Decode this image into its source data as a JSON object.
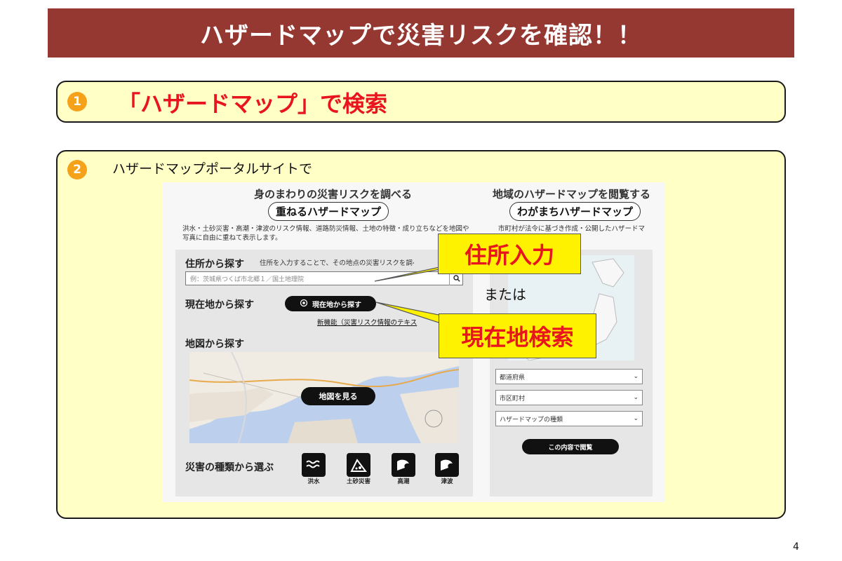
{
  "title": "ハザードマップで災害リスクを確認！！",
  "step1": {
    "number": "1",
    "text": "「ハザードマップ」で検索"
  },
  "step2": {
    "number": "2",
    "text": "ハザードマップポータルサイトで"
  },
  "portal": {
    "left_heading": "身のまわりの災害リスクを調べる",
    "left_pill": "重ねるハザードマップ",
    "left_desc": "洪水・土砂災害・高潮・津波のリスク情報、道路防災情報、土地の特徴・成り立ちなどを地図や写真に自由に重ねて表示します。",
    "right_heading": "地域のハザードマップを閲覧する",
    "right_pill": "わがまちハザードマップ",
    "right_desc": "市町村が法令に基づき作成・公開したハザードマ",
    "address_label": "住所から探す",
    "address_hint": "住所を入力することで、その地点の災害リスクを調べ",
    "address_placeholder": "例：茨城県つくば市北郷１／国土地理院",
    "current_label": "現在地から探す",
    "current_button": "現在地から探す",
    "new_feature_link": "新機能（災害リスク情報のテキス",
    "map_label": "地図から探す",
    "map_button": "地図を見る",
    "hazard_label": "災害の種類から選ぶ",
    "hazards": [
      {
        "label": "洪水",
        "icon": "flood-icon"
      },
      {
        "label": "土砂災害",
        "icon": "landslide-icon"
      },
      {
        "label": "高潮",
        "icon": "storm-surge-icon"
      },
      {
        "label": "津波",
        "icon": "tsunami-icon"
      }
    ],
    "selects": [
      "都道府県",
      "市区町村",
      "ハザードマップの種類"
    ],
    "view_button": "この内容で閲覧"
  },
  "callouts": {
    "address_input": "住所入力",
    "current_search": "現在地検索"
  },
  "or_text": "または",
  "page_number": "4",
  "colors": {
    "title_bg": "#963832",
    "box_bg": "#ffffc6",
    "accent_red": "#e8141e",
    "callout_yellow": "#fff200",
    "number_orange": "#f5a21a"
  }
}
